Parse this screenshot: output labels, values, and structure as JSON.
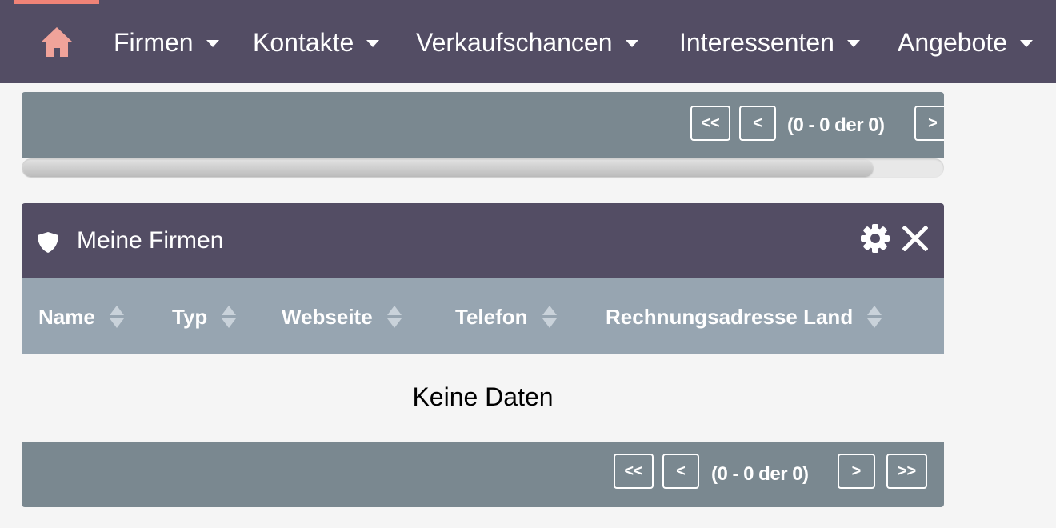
{
  "nav": {
    "items": [
      {
        "label": "Firmen"
      },
      {
        "label": "Kontakte"
      },
      {
        "label": "Verkaufschancen"
      },
      {
        "label": "Interessenten"
      },
      {
        "label": "Angebote"
      }
    ],
    "home_icon": "home-icon",
    "accent_color": "#f08377",
    "background_color": "#534d64"
  },
  "upper_pagination": {
    "first_label": "<<",
    "prev_label": "<",
    "info": "(0 - 0 der 0)",
    "next_label": ">"
  },
  "dashlet": {
    "title": "Meine Firmen",
    "icons": [
      "shield-icon",
      "gear-icon",
      "close-icon"
    ],
    "columns": [
      {
        "label": "Name"
      },
      {
        "label": "Typ"
      },
      {
        "label": "Webseite"
      },
      {
        "label": "Telefon"
      },
      {
        "label": "Rechnungsadresse Land"
      }
    ],
    "empty_message": "Keine Daten",
    "pagination": {
      "first_label": "<<",
      "prev_label": "<",
      "info": "(0 - 0 der 0)",
      "next_label": ">",
      "last_label": ">>"
    }
  }
}
